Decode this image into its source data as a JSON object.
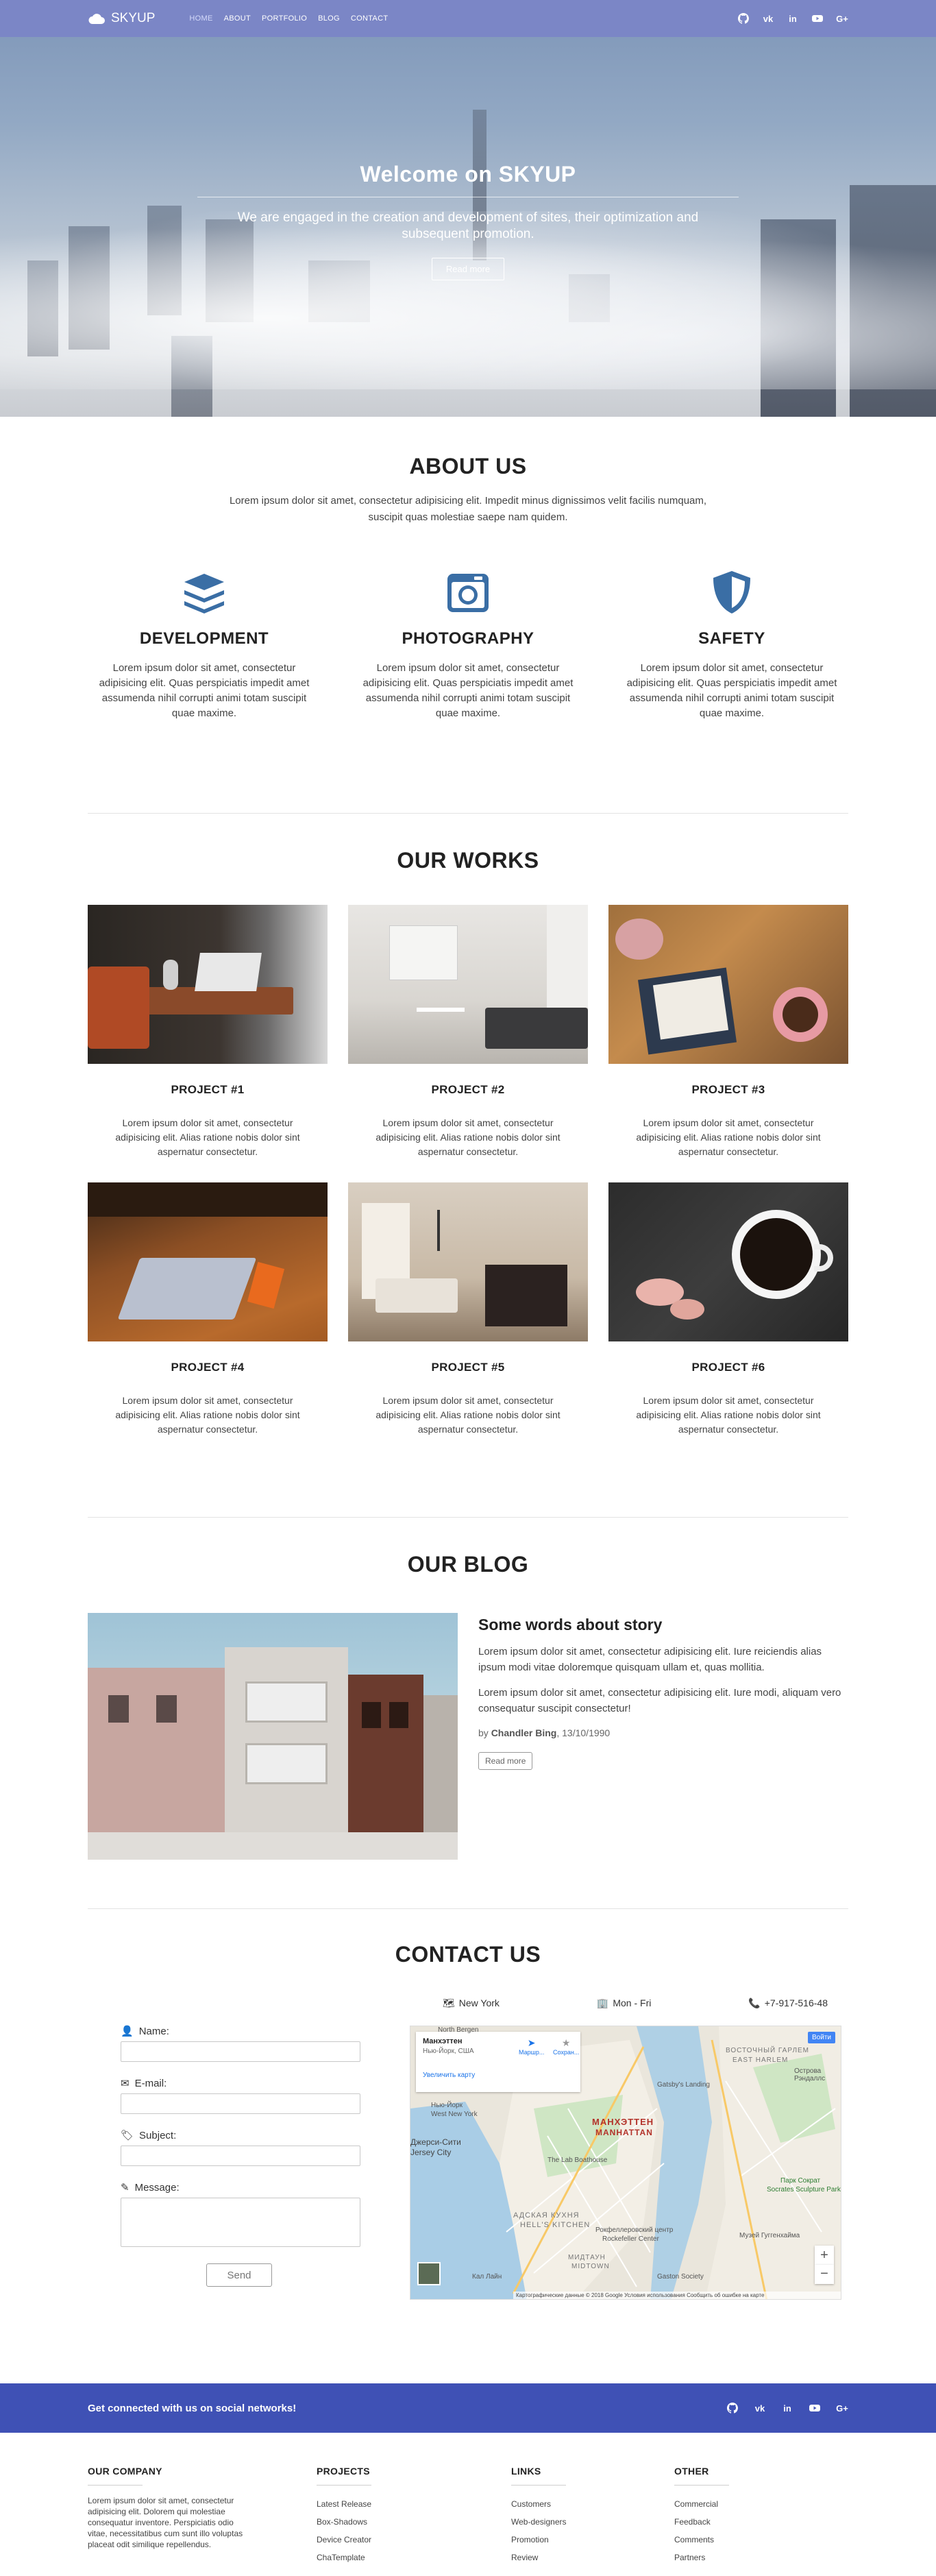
{
  "nav": {
    "logo": "SKYUP",
    "menu": [
      "HOME",
      "ABOUT",
      "PORTFOLIO",
      "BLOG",
      "CONTACT"
    ],
    "social_icons": [
      "github-icon",
      "vk-icon",
      "linkedin-icon",
      "youtube-icon",
      "google-plus-icon"
    ]
  },
  "hero": {
    "title": "Welcome on SKYUP",
    "subtitle": "We are engaged in the creation and development of sites, their optimization and subsequent promotion.",
    "button": "Read more"
  },
  "about": {
    "title": "ABOUT US",
    "lead": "Lorem ipsum dolor sit amet, consectetur adipisicing elit. Impedit minus dignissimos velit facilis numquam, suscipit quas molestiae saepe nam quidem.",
    "features": [
      {
        "icon": "layers-icon",
        "title": "DEVELOPMENT",
        "text": "Lorem ipsum dolor sit amet, consectetur adipisicing elit. Quas perspiciatis impedit amet assumenda nihil corrupti animi totam suscipit quae maxime."
      },
      {
        "icon": "camera-icon",
        "title": "PHOTOGRAPHY",
        "text": "Lorem ipsum dolor sit amet, consectetur adipisicing elit. Quas perspiciatis impedit amet assumenda nihil corrupti animi totam suscipit quae maxime."
      },
      {
        "icon": "shield-icon",
        "title": "SAFETY",
        "text": "Lorem ipsum dolor sit amet, consectetur adipisicing elit. Quas perspiciatis impedit amet assumenda nihil corrupti animi totam suscipit quae maxime."
      }
    ]
  },
  "works": {
    "title": "OUR WORKS",
    "projects": [
      {
        "title": "PROJECT #1",
        "text": "Lorem ipsum dolor sit amet, consectetur adipisicing elit. Alias ratione nobis dolor sint aspernatur consectetur."
      },
      {
        "title": "PROJECT #2",
        "text": "Lorem ipsum dolor sit amet, consectetur adipisicing elit. Alias ratione nobis dolor sint aspernatur consectetur."
      },
      {
        "title": "PROJECT #3",
        "text": "Lorem ipsum dolor sit amet, consectetur adipisicing elit. Alias ratione nobis dolor sint aspernatur consectetur."
      },
      {
        "title": "PROJECT #4",
        "text": "Lorem ipsum dolor sit amet, consectetur adipisicing elit. Alias ratione nobis dolor sint aspernatur consectetur."
      },
      {
        "title": "PROJECT #5",
        "text": "Lorem ipsum dolor sit amet, consectetur adipisicing elit. Alias ratione nobis dolor sint aspernatur consectetur."
      },
      {
        "title": "PROJECT #6",
        "text": "Lorem ipsum dolor sit amet, consectetur adipisicing elit. Alias ratione nobis dolor sint aspernatur consectetur."
      }
    ]
  },
  "blog": {
    "title": "OUR BLOG",
    "post_title": "Some words about story",
    "p1": "Lorem ipsum dolor sit amet, consectetur adipisicing elit. Iure reiciendis alias ipsum modi vitae doloremque quisquam ullam et, quas mollitia.",
    "p2": "Lorem ipsum dolor sit amet, consectetur adipisicing elit. Iure modi, aliquam vero consequatur suscipit consectetur!",
    "by_prefix": "by",
    "author": "Chandler Bing",
    "date": ", 13/10/1990",
    "button": "Read more"
  },
  "contact": {
    "title": "CONTACT US",
    "info": [
      {
        "icon": "map-icon",
        "text": "New York"
      },
      {
        "icon": "building-icon",
        "text": "Mon - Fri"
      },
      {
        "icon": "phone-icon",
        "text": "+7-917-516-48"
      }
    ],
    "fields": [
      {
        "icon": "user-icon",
        "label": "Name:"
      },
      {
        "icon": "envelope-icon",
        "label": "E-mail:"
      },
      {
        "icon": "tag-icon",
        "label": "Subject:"
      },
      {
        "icon": "pencil-icon",
        "label": "Message:"
      }
    ],
    "send": "Send",
    "map": {
      "place": "Манхэттен",
      "place_sub": "Нью-Йорк, США",
      "enlarge": "Увеличить карту",
      "route": "Маршр...",
      "save": "Сохран...",
      "signin": "Войти",
      "district": "МАНХЭТТЕН",
      "district_en": "MANHATTAN",
      "labels": [
        "North Bergen",
        "Нью-Йорк",
        "West New York",
        "Джерси-Сити",
        "Jersey City",
        "ВОСТОЧНЫЙ ГАРЛЕМ",
        "EAST HARLEM",
        "Острова Рэндаллс",
        "Парк Сократ",
        "Socrates Sculpture Park",
        "Рокфеллеровский центр",
        "Rockefeller Center",
        "Музей Гуггенхайма",
        "Gatsby's Landing",
        "The Lab Boathouse",
        "АДСКАЯ КУХНЯ",
        "HELL'S KITCHEN",
        "МИДТАУН",
        "MIDTOWN",
        "Кал Лайн",
        "Gaston Society"
      ],
      "footer": "Картографические данные © 2018 Google   Условия использования   Сообщить об ошибке на карте",
      "zoom_in": "+",
      "zoom_out": "−"
    }
  },
  "socbar": {
    "text": "Get connected with us on social networks!"
  },
  "footer": {
    "cols": [
      {
        "title": "OUR COMPANY",
        "blurb": "Lorem ipsum dolor sit amet, consectetur adipisicing elit. Dolorem qui molestiae consequatur inventore. Perspiciatis odio vitae, necessitatibus cum sunt illo voluptas placeat odit similique repellendus."
      },
      {
        "title": "PROJECTS",
        "items": [
          "Latest Release",
          "Box-Shadows",
          "Device Creator",
          "ChaTemplate"
        ]
      },
      {
        "title": "LINKS",
        "items": [
          "Customers",
          "Web-designers",
          "Promotion",
          "Review"
        ]
      },
      {
        "title": "OTHER",
        "items": [
          "Commercial",
          "Feedback",
          "Comments",
          "Partners"
        ]
      }
    ]
  },
  "colors": {
    "nav": "#7b86c6",
    "accent": "#3f51b5",
    "icon_blue": "#3a6ea5"
  }
}
